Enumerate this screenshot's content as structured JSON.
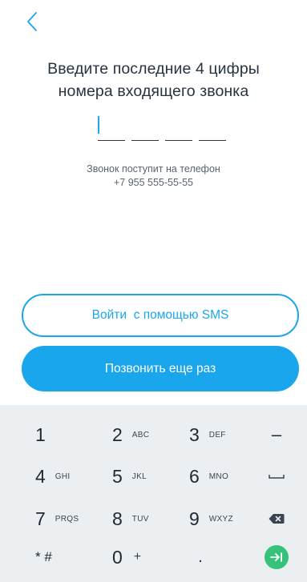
{
  "nav": {
    "back_icon": "chevron-left-icon"
  },
  "title": {
    "line1": "Введите последние 4 цифры",
    "line2": "номера входящего звонка"
  },
  "code_input": {
    "digits_entered": 0,
    "length": 4,
    "accent_color": "#1aa6ec"
  },
  "info": {
    "line1": "Звонок поступит на телефон",
    "phone": "+7 955 555-55-55"
  },
  "buttons": {
    "sms_label": "Войти  с помощью SMS",
    "call_again_label": "Позвонить еще раз"
  },
  "keyboard": {
    "keys": [
      {
        "num": "1",
        "letters": ""
      },
      {
        "num": "2",
        "letters": "ABC"
      },
      {
        "num": "3",
        "letters": "DEF"
      },
      {
        "num": "4",
        "letters": "GHI"
      },
      {
        "num": "5",
        "letters": "JKL"
      },
      {
        "num": "6",
        "letters": "MNO"
      },
      {
        "num": "7",
        "letters": "PRQS"
      },
      {
        "num": "8",
        "letters": "TUV"
      },
      {
        "num": "9",
        "letters": "WXYZ"
      },
      {
        "num": "0",
        "letters": "+"
      }
    ],
    "minus_key": "–",
    "star_hash_key": "* #",
    "period_key": ".",
    "space_icon": "space-icon",
    "backspace_icon": "backspace-icon",
    "go_icon": "next-arrow-icon",
    "go_color": "#35c27a"
  }
}
